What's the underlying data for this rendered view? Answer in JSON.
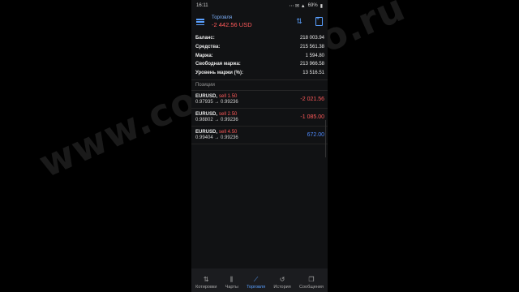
{
  "status_bar": {
    "time": "16:11",
    "icons_text": "⋯ ✉ ▲",
    "right_text": "69%",
    "battery_icon": "battery-icon"
  },
  "header": {
    "title": "Торговля",
    "balance_change": "-2 442.56 USD"
  },
  "summary": [
    {
      "label": "Баланс:",
      "value": "218 003.94"
    },
    {
      "label": "Средства:",
      "value": "215 561.38"
    },
    {
      "label": "Маржа:",
      "value": "1 594.80"
    },
    {
      "label": "Свободная маржа:",
      "value": "213 966.58"
    },
    {
      "label": "Уровень маржи (%):",
      "value": "13 516.51"
    }
  ],
  "positions_label": "Позиции",
  "positions": [
    {
      "symbol": "EURUSD,",
      "side": "sell 1.50",
      "prices": "0.97935 → 0.99236",
      "profit": "-2 021.56",
      "color": "#ff5a5a"
    },
    {
      "symbol": "EURUSD,",
      "side": "sell 2.50",
      "prices": "0.98802 → 0.99236",
      "profit": "-1 085.00",
      "color": "#ff5a5a"
    },
    {
      "symbol": "EURUSD,",
      "side": "sell 4.50",
      "prices": "0.99404 → 0.99236",
      "profit": "672.00",
      "color": "#4f8bff"
    }
  ],
  "bottom_nav": [
    {
      "label": "Котировки",
      "icon": "arrows-updown-icon"
    },
    {
      "label": "Чарты",
      "icon": "candles-icon"
    },
    {
      "label": "Торговля",
      "icon": "trend-icon",
      "active": true
    },
    {
      "label": "История",
      "icon": "history-icon"
    },
    {
      "label": "Сообщения",
      "icon": "messages-icon"
    }
  ],
  "watermark": "www.colibrmeo.ru"
}
